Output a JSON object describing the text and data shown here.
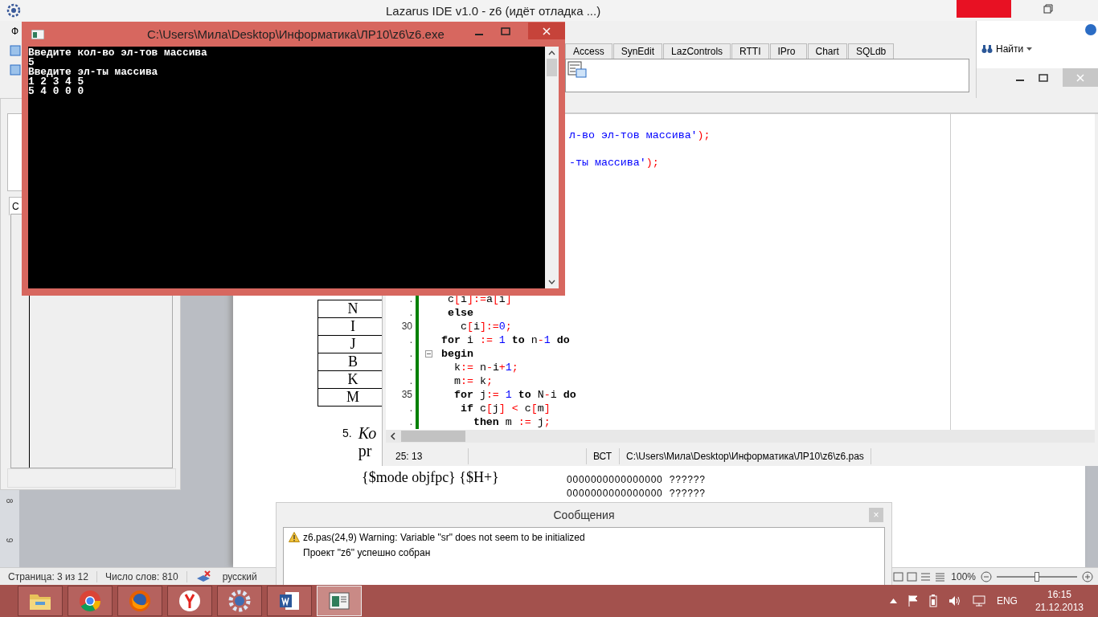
{
  "lazarus": {
    "title": "Lazarus IDE v1.0 - z6 (идёт отладка ...)",
    "menu_fragment": "Ф",
    "inspector_tab": "С",
    "palette_tabs": [
      {
        "label": "Access",
        "selected": false
      },
      {
        "label": "SynEdit",
        "selected": false
      },
      {
        "label": "LazControls",
        "selected": false
      },
      {
        "label": "RTTI",
        "selected": false
      },
      {
        "label": "IPro",
        "selected": false
      },
      {
        "label": "Chart",
        "selected": false
      },
      {
        "label": "SQLdb",
        "selected": false
      }
    ]
  },
  "word": {
    "find": "Найти",
    "ruler_numbers": [
      "8",
      "9"
    ],
    "table_cells": [
      "N",
      "I",
      "J",
      "B",
      "K",
      "M"
    ],
    "list_number": "5.",
    "list_lines": [
      "Ко",
      "pr"
    ],
    "code_text": "{$mode objfpc} {$H+}",
    "right_lines": [
      "0000000000000000  ??????",
      "0000000000000000  ??????"
    ],
    "status": {
      "page": "Страница: 3 из 12",
      "words": "Число слов: 810",
      "language": "русский"
    },
    "zoom": {
      "text": "100%",
      "level": 0.5
    }
  },
  "editor": {
    "top_lines": [
      [
        {
          "kind": "str",
          "text": "л-во эл-тов массива'"
        },
        {
          "kind": "sym",
          "text": ");"
        }
      ],
      [
        {
          "kind": "str",
          "text": "-ты массива'"
        },
        {
          "kind": "sym",
          "text": ");"
        }
      ]
    ],
    "lines": [
      {
        "gutter": ".",
        "fold": false,
        "tokens": [
          {
            "kind": "id",
            "text": " c"
          },
          {
            "kind": "sym",
            "text": "["
          },
          {
            "kind": "id",
            "text": "i"
          },
          {
            "kind": "sym",
            "text": "]:="
          },
          {
            "kind": "id",
            "text": "a"
          },
          {
            "kind": "sym",
            "text": "["
          },
          {
            "kind": "id",
            "text": "i"
          },
          {
            "kind": "sym",
            "text": "]"
          }
        ]
      },
      {
        "gutter": ".",
        "fold": false,
        "tokens": [
          {
            "kind": "kw",
            "text": " else"
          }
        ]
      },
      {
        "gutter": "30",
        "fold": false,
        "tokens": [
          {
            "kind": "id",
            "text": "   c"
          },
          {
            "kind": "sym",
            "text": "["
          },
          {
            "kind": "id",
            "text": "i"
          },
          {
            "kind": "sym",
            "text": "]:="
          },
          {
            "kind": "num",
            "text": "0"
          },
          {
            "kind": "sym",
            "text": ";"
          }
        ]
      },
      {
        "gutter": ".",
        "fold": false,
        "tokens": [
          {
            "kind": "kw",
            "text": "for"
          },
          {
            "kind": "id",
            "text": " i "
          },
          {
            "kind": "sym",
            "text": ":="
          },
          {
            "kind": "num",
            "text": " 1 "
          },
          {
            "kind": "kw",
            "text": "to"
          },
          {
            "kind": "id",
            "text": " n"
          },
          {
            "kind": "sym",
            "text": "-"
          },
          {
            "kind": "num",
            "text": "1 "
          },
          {
            "kind": "kw",
            "text": "do"
          }
        ]
      },
      {
        "gutter": ".",
        "fold": true,
        "tokens": [
          {
            "kind": "kw",
            "text": "begin"
          }
        ]
      },
      {
        "gutter": ".",
        "fold": false,
        "tokens": [
          {
            "kind": "id",
            "text": "  k"
          },
          {
            "kind": "sym",
            "text": ":="
          },
          {
            "kind": "id",
            "text": " n"
          },
          {
            "kind": "sym",
            "text": "-"
          },
          {
            "kind": "id",
            "text": "i"
          },
          {
            "kind": "sym",
            "text": "+"
          },
          {
            "kind": "num",
            "text": "1"
          },
          {
            "kind": "sym",
            "text": ";"
          }
        ]
      },
      {
        "gutter": ".",
        "fold": false,
        "tokens": [
          {
            "kind": "id",
            "text": "  m"
          },
          {
            "kind": "sym",
            "text": ":="
          },
          {
            "kind": "id",
            "text": " k"
          },
          {
            "kind": "sym",
            "text": ";"
          }
        ]
      },
      {
        "gutter": "35",
        "fold": false,
        "tokens": [
          {
            "kind": "kw",
            "text": "  for"
          },
          {
            "kind": "id",
            "text": " j"
          },
          {
            "kind": "sym",
            "text": ":="
          },
          {
            "kind": "num",
            "text": " 1 "
          },
          {
            "kind": "kw",
            "text": "to"
          },
          {
            "kind": "id",
            "text": " N"
          },
          {
            "kind": "sym",
            "text": "-"
          },
          {
            "kind": "id",
            "text": "i "
          },
          {
            "kind": "kw",
            "text": "do"
          }
        ]
      },
      {
        "gutter": ".",
        "fold": false,
        "tokens": [
          {
            "kind": "kw",
            "text": "   if"
          },
          {
            "kind": "id",
            "text": " c"
          },
          {
            "kind": "sym",
            "text": "["
          },
          {
            "kind": "id",
            "text": "j"
          },
          {
            "kind": "sym",
            "text": "] < "
          },
          {
            "kind": "id",
            "text": "c"
          },
          {
            "kind": "sym",
            "text": "["
          },
          {
            "kind": "id",
            "text": "m"
          },
          {
            "kind": "sym",
            "text": "]"
          }
        ]
      },
      {
        "gutter": ".",
        "fold": false,
        "tokens": [
          {
            "kind": "kw",
            "text": "     then"
          },
          {
            "kind": "id",
            "text": " m "
          },
          {
            "kind": "sym",
            "text": ":="
          },
          {
            "kind": "id",
            "text": " j"
          },
          {
            "kind": "sym",
            "text": ";"
          }
        ]
      }
    ],
    "status": {
      "position": "25: 13",
      "mode": "ВСТ",
      "path": "C:\\Users\\Мила\\Desktop\\Информатика\\ЛР10\\z6\\z6.pas"
    }
  },
  "console": {
    "title": "C:\\Users\\Мила\\Desktop\\Информатика\\ЛР10\\z6\\z6.exe",
    "lines": [
      "Введите кол-во эл-тов массива",
      "5",
      "Введите эл-ты массива",
      "1 2 3 4 5",
      "5 4 0 0 0"
    ]
  },
  "messages": {
    "title": "Сообщения",
    "close": "×",
    "items": [
      {
        "kind": "warning",
        "text": "z6.pas(24,9) Warning: Variable \"sr\" does not seem to be initialized"
      },
      {
        "kind": "info",
        "text": "Проект \"z6\" успешно собран"
      }
    ]
  },
  "taskbar": {
    "apps": [
      {
        "kind": "folder",
        "selected": false
      },
      {
        "kind": "chrome",
        "selected": false
      },
      {
        "kind": "firefox",
        "selected": false
      },
      {
        "kind": "yandex",
        "selected": false
      },
      {
        "kind": "lazarus",
        "selected": false
      },
      {
        "kind": "word",
        "selected": false
      },
      {
        "kind": "console",
        "selected": true
      }
    ],
    "language": "ENG",
    "time": "16:15",
    "date": "21.12.2013"
  }
}
